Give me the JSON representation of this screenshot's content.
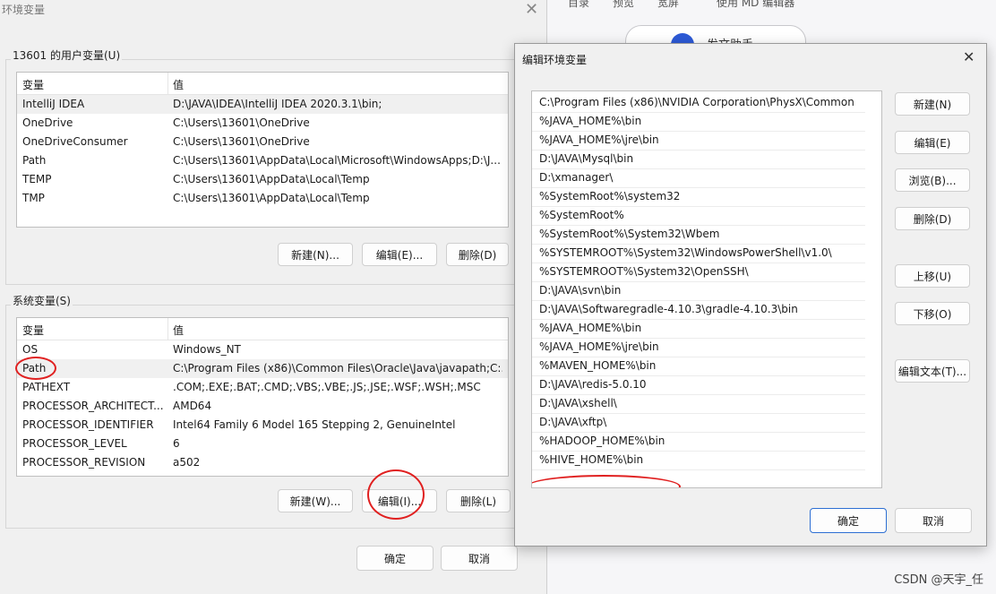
{
  "background": {
    "toolbar": [
      "目录",
      "预览",
      "宽屏",
      "使用 MD 编辑器"
    ],
    "assistant_label": "发文助手",
    "watermark": "CSDN @天宇_任"
  },
  "env_dialog": {
    "title": "环境变量",
    "close": "✕",
    "user_group_label": "13601 的用户变量(U)",
    "user_headers": [
      "变量",
      "值"
    ],
    "user_rows": [
      [
        "IntelliJ IDEA",
        "D:\\JAVA\\IDEA\\IntelliJ IDEA 2020.3.1\\bin;"
      ],
      [
        "OneDrive",
        "C:\\Users\\13601\\OneDrive"
      ],
      [
        "OneDriveConsumer",
        "C:\\Users\\13601\\OneDrive"
      ],
      [
        "Path",
        "C:\\Users\\13601\\AppData\\Local\\Microsoft\\WindowsApps;D:\\J..."
      ],
      [
        "TEMP",
        "C:\\Users\\13601\\AppData\\Local\\Temp"
      ],
      [
        "TMP",
        "C:\\Users\\13601\\AppData\\Local\\Temp"
      ]
    ],
    "user_buttons": [
      "新建(N)...",
      "编辑(E)...",
      "删除(D)"
    ],
    "sys_group_label": "系统变量(S)",
    "sys_headers": [
      "变量",
      "值"
    ],
    "sys_rows": [
      [
        "OS",
        "Windows_NT"
      ],
      [
        "Path",
        "C:\\Program Files (x86)\\Common Files\\Oracle\\Java\\javapath;C:..."
      ],
      [
        "PATHEXT",
        ".COM;.EXE;.BAT;.CMD;.VBS;.VBE;.JS;.JSE;.WSF;.WSH;.MSC"
      ],
      [
        "PROCESSOR_ARCHITECT...",
        "AMD64"
      ],
      [
        "PROCESSOR_IDENTIFIER",
        "Intel64 Family 6 Model 165 Stepping 2, GenuineIntel"
      ],
      [
        "PROCESSOR_LEVEL",
        "6"
      ],
      [
        "PROCESSOR_REVISION",
        "a502"
      ]
    ],
    "sys_buttons": [
      "新建(W)...",
      "编辑(I)...",
      "删除(L)"
    ],
    "ok": "确定",
    "cancel": "取消"
  },
  "edit_dialog": {
    "title": "编辑环境变量",
    "close": "✕",
    "paths": [
      "C:\\Program Files (x86)\\NVIDIA Corporation\\PhysX\\Common",
      "%JAVA_HOME%\\bin",
      "%JAVA_HOME%\\jre\\bin",
      "D:\\JAVA\\Mysql\\bin",
      "D:\\xmanager\\",
      "%SystemRoot%\\system32",
      "%SystemRoot%",
      "%SystemRoot%\\System32\\Wbem",
      "%SYSTEMROOT%\\System32\\WindowsPowerShell\\v1.0\\",
      "%SYSTEMROOT%\\System32\\OpenSSH\\",
      "D:\\JAVA\\svn\\bin",
      "D:\\JAVA\\Softwaregradle-4.10.3\\gradle-4.10.3\\bin",
      "%JAVA_HOME%\\bin",
      "%JAVA_HOME%\\jre\\bin",
      "%MAVEN_HOME%\\bin",
      "D:\\JAVA\\redis-5.0.10",
      "D:\\JAVA\\xshell\\",
      "D:\\JAVA\\xftp\\",
      "%HADOOP_HOME%\\bin",
      "%HIVE_HOME%\\bin"
    ],
    "buttons": [
      "新建(N)",
      "编辑(E)",
      "浏览(B)...",
      "删除(D)",
      "上移(U)",
      "下移(O)",
      "编辑文本(T)..."
    ],
    "ok": "确定",
    "cancel": "取消"
  },
  "colors": {
    "annotation": "#e02020",
    "primary_border": "#2d6fd3"
  }
}
